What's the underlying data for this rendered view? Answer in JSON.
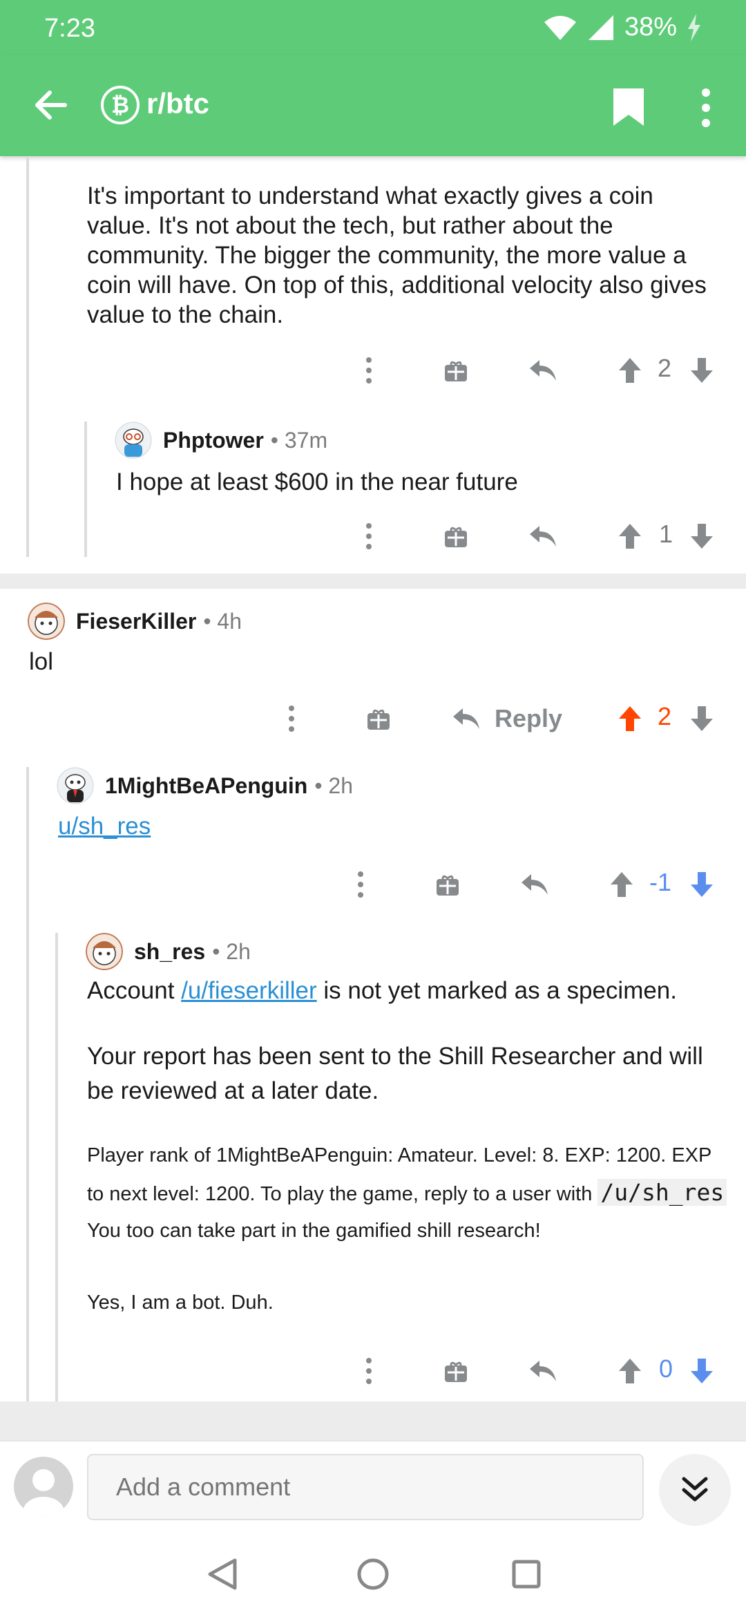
{
  "status": {
    "time": "7:23",
    "battery": "38%"
  },
  "app_bar": {
    "subreddit": "r/btc",
    "sub_icon_glyph": "₿"
  },
  "comments": {
    "c1": {
      "text": "It's important to understand what exactly gives a coin value. It's not about the tech, but rather about the community. The bigger the community, the more value a coin will have. On top of this, additional velocity also gives value to the chain.",
      "score": "2"
    },
    "c2": {
      "author": "Phptower",
      "age": "• 37m",
      "text": "I hope at least $600 in the near future",
      "score": "1"
    },
    "c3": {
      "author": "FieserKiller",
      "age": "• 4h",
      "text": "lol",
      "reply_label": "Reply",
      "score": "2"
    },
    "c4": {
      "author": "1MightBeAPenguin",
      "age": "• 2h",
      "link": "u/sh_res",
      "score": "-1"
    },
    "c5": {
      "author": "sh_res",
      "age": "• 2h",
      "p1_pre": "Account ",
      "p1_link": "/u/fieserkiller",
      "p1_post": " is not yet marked as a specimen.",
      "p2": "Your report has been sent to the Shill Researcher and will be reviewed at a later date.",
      "p3_pre": "Player rank of 1MightBeAPenguin: Amateur. Level: 8. EXP: 1200. EXP to next level: 1200. To play the game, reply to a user with ",
      "p3_code": "/u/sh_res",
      "p3_post": " You too can take part in the gamified shill research!",
      "p4": "Yes, I am a bot. Duh.",
      "score": "0"
    }
  },
  "bottom": {
    "comment_placeholder": "Add a comment"
  },
  "colors": {
    "accent_green": "#5ecb78",
    "upvote_orange": "#ff4500",
    "downvote_blue": "#5a8dee",
    "link_blue": "#2a8fd4"
  }
}
